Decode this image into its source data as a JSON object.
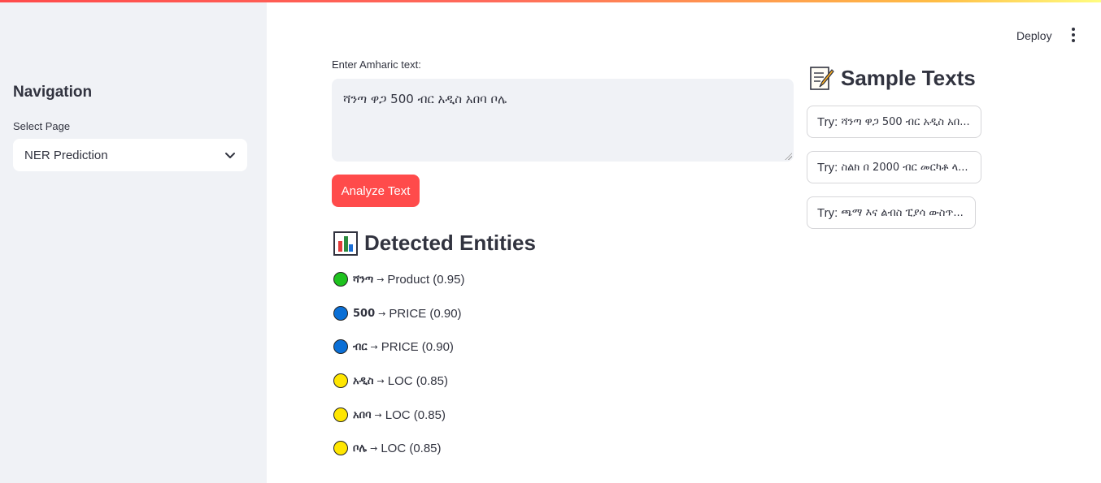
{
  "header": {
    "deploy_label": "Deploy",
    "menu_icon": "more-vertical-icon"
  },
  "sidebar": {
    "title": "Navigation",
    "select_label": "Select Page",
    "select_value": "NER Prediction",
    "select_icon": "chevron-down-icon"
  },
  "main": {
    "input_label": "Enter Amharic text:",
    "input_value": "ሻንጣ ዋጋ 500 ብር አዲስ አበባ ቦሌ",
    "analyze_label": "Analyze Text",
    "entities_title": "Detected Entities",
    "entities_icon": "bar-chart-icon",
    "entities": [
      {
        "text": "ሻንጣ",
        "label": "Product (0.95)",
        "color": "#1ec21e"
      },
      {
        "text": "500",
        "label": "PRICE (0.90)",
        "color": "#0a6fd6"
      },
      {
        "text": "ብር",
        "label": "PRICE (0.90)",
        "color": "#0a6fd6"
      },
      {
        "text": "አዲስ",
        "label": "LOC (0.85)",
        "color": "#ffe600"
      },
      {
        "text": "አበባ",
        "label": "LOC (0.85)",
        "color": "#ffe600"
      },
      {
        "text": "ቦሌ",
        "label": "LOC (0.85)",
        "color": "#ffe600"
      }
    ]
  },
  "samples": {
    "title": "Sample Texts",
    "title_icon": "memo-icon",
    "try_prefix": "Try: ",
    "buttons": [
      "ሻንጣ ዋጋ 500 ብር አዲስ አበ...",
      "ስልክ በ 2000 ብር መርካቶ ላ...",
      "ጫማ እና ልብስ ፒያሳ ውስጥ..."
    ]
  },
  "colors": {
    "accent": "#ff4b4b",
    "sidebar_bg": "#f0f2f6",
    "text": "#31333f"
  }
}
